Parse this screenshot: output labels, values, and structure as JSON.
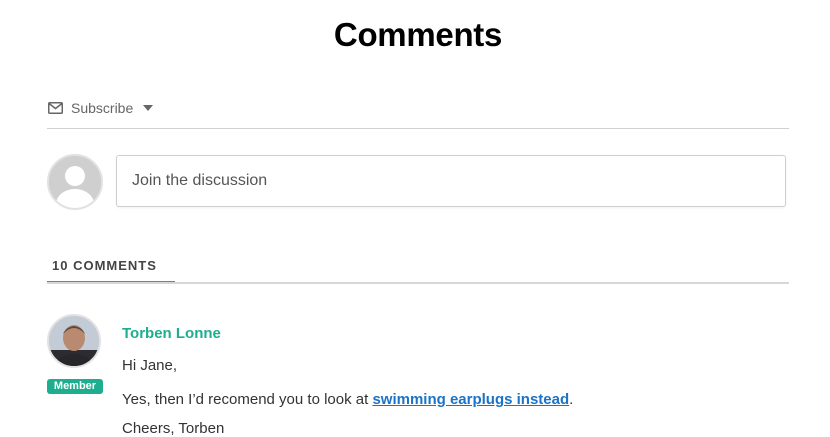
{
  "header": {
    "title": "Comments"
  },
  "subscribe": {
    "label": "Subscribe",
    "icon": "envelope-icon"
  },
  "composer": {
    "placeholder": "Join the discussion",
    "avatar_icon": "user-silhouette-icon"
  },
  "comments_tab": {
    "label": "10 COMMENTS",
    "accent": "#1cae8f"
  },
  "comment": {
    "author": "Torben Lonne",
    "badge": "Member",
    "greeting": "Hi Jane,",
    "text_before": "Yes, then I’d recomend you to look at ",
    "link_text": "swimming earplugs instead",
    "text_after": ".",
    "partial_line": "Cheers, Torben"
  },
  "colors": {
    "accent": "#1cae8f",
    "link": "#1a73c8"
  }
}
